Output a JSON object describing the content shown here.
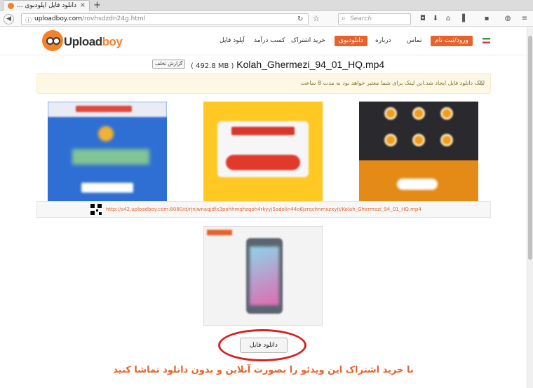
{
  "browser": {
    "tab_title": "دانلود فایل آپلودبوی ...",
    "tab_close": "×",
    "new_tab": "+",
    "url_host": "uploadboy.com",
    "url_path": "/rovhsdzdn24g.html",
    "search_placeholder": "Search",
    "icons": [
      "back-arrow-icon",
      "lock-icon",
      "reload-icon",
      "star-icon",
      "search-icon",
      "pocket-icon",
      "download-icon",
      "home-icon",
      "menu-icon"
    ]
  },
  "site": {
    "logo_text_main": "Upload",
    "logo_text_accent": "boy",
    "nav": {
      "login": "ورود/ثبت نام",
      "contact": "تماس",
      "about": "درباره",
      "download_bot": "دانلودبوی",
      "buy_subscription": "خرید اشتراک",
      "earn_money": "کسب درآمد",
      "upload_file": "آپلود فایل"
    }
  },
  "file": {
    "name": "Kolah_Ghermezi_94_01_HQ.mp4",
    "size": "( 492.8 MB )",
    "report_label": "گزارش تخلف"
  },
  "alert": {
    "message": "لینک دانلود فایل ایجاد شد.این لینک برای شما معتبر خواهد بود به مدت 8 ساعت",
    "close": "x"
  },
  "download": {
    "link": "http://s42.uploadboy.com:8080/d/rjnjwnaqjdfx3pohhmqhzqoh4rkyyj5adolin44o6jzrqchnmxzxyjt/Kolah_Ghermezi_94_01_HQ.mp4",
    "button_label": "دانلود فایل",
    "promo_text": "با خرید اشتراک این ویدئو را بصورت آنلاین و بدون دانلود تماشا کنید"
  },
  "colors": {
    "brand": "#e8632b",
    "alert_bg": "#fcf8e3",
    "highlight": "#d82020"
  }
}
